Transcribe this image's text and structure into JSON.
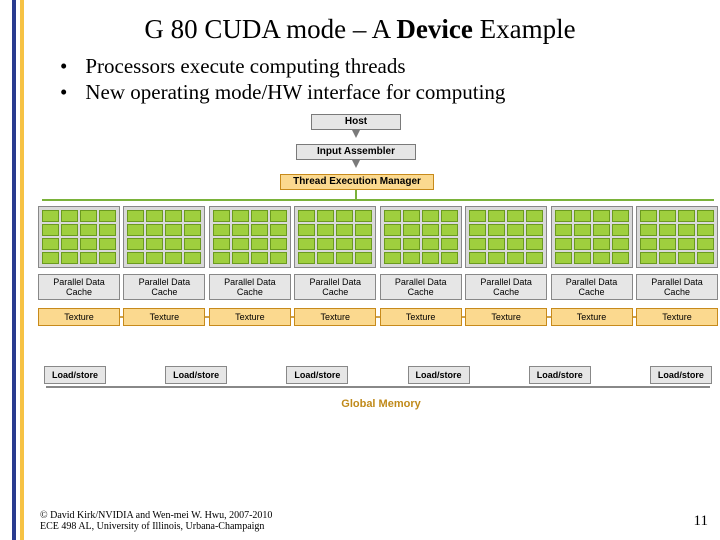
{
  "title": {
    "pre": "G 80 CUDA mode – A ",
    "bold": "Device",
    "post": " Example"
  },
  "bullets": [
    "Processors execute computing threads",
    "New operating mode/HW interface for computing"
  ],
  "boxes": {
    "host": "Host",
    "input": "Input Assembler",
    "tem": "Thread Execution Manager",
    "pdc": "Parallel Data Cache",
    "tex": "Texture",
    "ls": "Load/store",
    "gmem": "Global Memory"
  },
  "counts": {
    "sp": 8,
    "pdc": 8,
    "tex": 8,
    "ls": 6
  },
  "copyright": "© David Kirk/NVIDIA and Wen-mei W. Hwu, 2007-2010\nECE 498 AL, University of Illinois, Urbana-Champaign",
  "page": "11"
}
